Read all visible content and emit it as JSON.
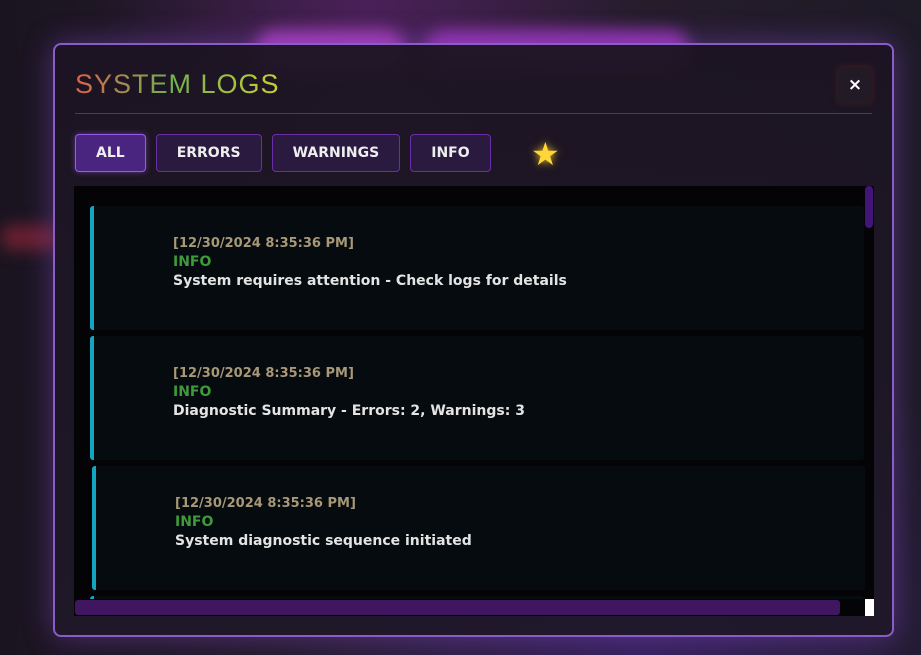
{
  "modal": {
    "title": "SYSTEM LOGS",
    "close_label": "×"
  },
  "filters": [
    {
      "label": "ALL",
      "active": true
    },
    {
      "label": "ERRORS"
    },
    {
      "label": "WARNINGS"
    },
    {
      "label": "INFO"
    }
  ],
  "logs": [
    {
      "timestamp": "[12/30/2024 8:35:36 PM]",
      "level": "INFO",
      "message": "System requires attention - Check logs for details"
    },
    {
      "timestamp": "[12/30/2024 8:35:36 PM]",
      "level": "INFO",
      "message": "Diagnostic Summary - Errors: 2, Warnings: 3"
    },
    {
      "timestamp": "[12/30/2024 8:35:36 PM]",
      "level": "INFO",
      "message": "System diagnostic sequence initiated"
    }
  ],
  "colors": {
    "accent": "#8a5cc8",
    "info": "#3f9a3a",
    "entry_border": "#13a6c0"
  },
  "icons": {
    "decoration": "star-icon"
  }
}
